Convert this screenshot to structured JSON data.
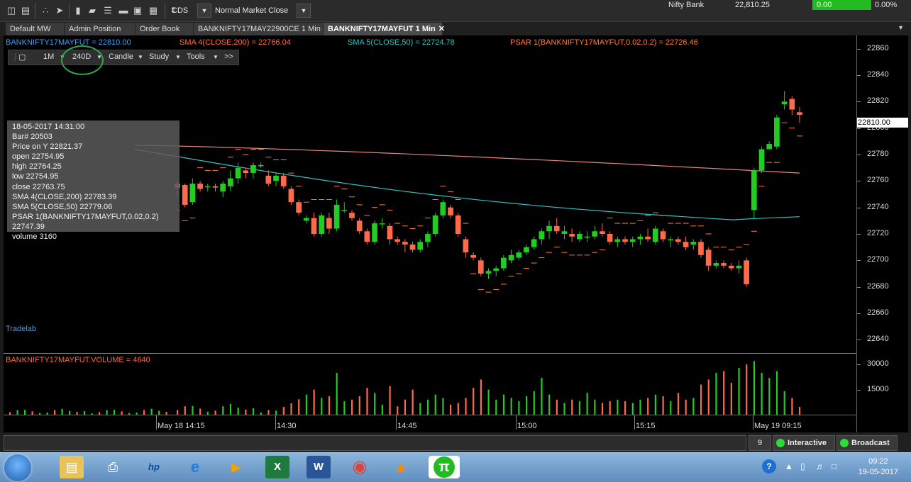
{
  "toolbar": {
    "exchange": "CDS",
    "market_status": "Normal Market Close",
    "ticker": {
      "name": "Nifty Bank",
      "value": "22,810.25",
      "change": "0.00",
      "pct": "0.00%"
    }
  },
  "tabs": [
    {
      "label": "Default MW"
    },
    {
      "label": "Admin Position"
    },
    {
      "label": "Order Book"
    },
    {
      "label": "BANKNIFTY17MAY22900CE 1 Min"
    },
    {
      "label": "BANKNIFTY17MAYFUT 1 Min",
      "close": "✕"
    }
  ],
  "indicators": {
    "price": "BANKNIFTY17MAYFUT = 22810.00",
    "sma200": "SMA 4(CLOSE,200) = 22766.04",
    "sma50": "SMA 5(CLOSE,50) = 22724.78",
    "psar": "PSAR 1(BANKNIFTY17MAYFUT,0.02,0.2) = 22726.46"
  },
  "chart_toolbar": {
    "interval": "1M",
    "duration": "240D",
    "type": "Candle",
    "study": "Study",
    "tools": "Tools",
    "more": ">>"
  },
  "infobox": [
    "18-05-2017 14:31:00",
    "Bar# 20503",
    "Price on Y  22821.37",
    "open  22754.95",
    "high  22764.25",
    "low  22754.95",
    "close  22763.75",
    "SMA 4(CLOSE,200)  22783.39",
    "SMA 5(CLOSE,50)  22779.06",
    "PSAR 1(BANKNIFTY17MAYFUT,0.02,0.2)  22747.39",
    "volume 3160"
  ],
  "watermark": "Tradelab",
  "volume_label": "BANKNIFTY17MAYFUT.VOLUME = 4640",
  "price_tag": "22810.00",
  "colors": {
    "up": "#22cc22",
    "down": "#ff6a4a",
    "sma200": "#e8857a",
    "sma50": "#2ac4c4",
    "psar": "#ff7a3a",
    "accent_green": "#22bb22"
  },
  "status": {
    "count": "9",
    "interactive": "Interactive",
    "broadcast": "Broadcast"
  },
  "taskbar": {
    "time": "09:22",
    "date": "19-05-2017"
  },
  "chart_data": {
    "type": "candlestick",
    "title": "",
    "price_axis": {
      "ticks": [
        22860,
        22840,
        22820,
        22800,
        22780,
        22760,
        22740,
        22720,
        22700,
        22680,
        22660,
        22640
      ],
      "range": [
        22630,
        22870
      ]
    },
    "volume_axis": {
      "ticks": [
        30000,
        15000
      ],
      "range": [
        0,
        36000
      ]
    },
    "time_labels": [
      "May 18 14:15",
      "14:30",
      "14:45",
      "15:00",
      "15:15",
      "May 19 09:15"
    ],
    "candles": [
      {
        "o": 22758,
        "h": 22760,
        "l": 22748,
        "c": 22755,
        "v": 2800
      },
      {
        "o": 22757,
        "h": 22758,
        "l": 22740,
        "c": 22742,
        "v": 5000
      },
      {
        "o": 22744,
        "h": 22762,
        "l": 22742,
        "c": 22758,
        "v": 5200
      },
      {
        "o": 22758,
        "h": 22760,
        "l": 22752,
        "c": 22754,
        "v": 3600
      },
      {
        "o": 22756,
        "h": 22758,
        "l": 22752,
        "c": 22756,
        "v": 1800
      },
      {
        "o": 22756,
        "h": 22758,
        "l": 22752,
        "c": 22755,
        "v": 2400
      },
      {
        "o": 22752,
        "h": 22760,
        "l": 22748,
        "c": 22758,
        "v": 5000
      },
      {
        "o": 22756,
        "h": 22768,
        "l": 22752,
        "c": 22762,
        "v": 6400
      },
      {
        "o": 22762,
        "h": 22774,
        "l": 22758,
        "c": 22770,
        "v": 4200
      },
      {
        "o": 22768,
        "h": 22770,
        "l": 22762,
        "c": 22766,
        "v": 3000
      },
      {
        "o": 22766,
        "h": 22774,
        "l": 22762,
        "c": 22772,
        "v": 3800
      },
      {
        "o": 22772,
        "h": 22774,
        "l": 22770,
        "c": 22772,
        "v": 1400
      },
      {
        "o": 22764,
        "h": 22768,
        "l": 22756,
        "c": 22758,
        "v": 2800
      },
      {
        "o": 22760,
        "h": 22766,
        "l": 22756,
        "c": 22764,
        "v": 2400
      },
      {
        "o": 22764,
        "h": 22766,
        "l": 22754,
        "c": 22756,
        "v": 4600
      },
      {
        "o": 22754,
        "h": 22756,
        "l": 22742,
        "c": 22744,
        "v": 6800
      },
      {
        "o": 22744,
        "h": 22746,
        "l": 22734,
        "c": 22736,
        "v": 9200
      },
      {
        "o": 22730,
        "h": 22734,
        "l": 22728,
        "c": 22732,
        "v": 12000
      },
      {
        "o": 22732,
        "h": 22736,
        "l": 22718,
        "c": 22720,
        "v": 15000
      },
      {
        "o": 22720,
        "h": 22736,
        "l": 22718,
        "c": 22734,
        "v": 10000
      },
      {
        "o": 22732,
        "h": 22736,
        "l": 22720,
        "c": 22724,
        "v": 11000
      },
      {
        "o": 22724,
        "h": 22746,
        "l": 22722,
        "c": 22742,
        "v": 25000
      },
      {
        "o": 22738,
        "h": 22744,
        "l": 22736,
        "c": 22738,
        "v": 8000
      },
      {
        "o": 22736,
        "h": 22738,
        "l": 22730,
        "c": 22732,
        "v": 9000
      },
      {
        "o": 22730,
        "h": 22732,
        "l": 22720,
        "c": 22722,
        "v": 11000
      },
      {
        "o": 22722,
        "h": 22724,
        "l": 22712,
        "c": 22714,
        "v": 16000
      },
      {
        "o": 22714,
        "h": 22730,
        "l": 22712,
        "c": 22728,
        "v": 13000
      },
      {
        "o": 22728,
        "h": 22732,
        "l": 22724,
        "c": 22728,
        "v": 6000
      },
      {
        "o": 22726,
        "h": 22728,
        "l": 22712,
        "c": 22716,
        "v": 17000
      },
      {
        "o": 22716,
        "h": 22718,
        "l": 22712,
        "c": 22714,
        "v": 5000
      },
      {
        "o": 22714,
        "h": 22716,
        "l": 22706,
        "c": 22712,
        "v": 9000
      },
      {
        "o": 22712,
        "h": 22714,
        "l": 22706,
        "c": 22708,
        "v": 15000
      },
      {
        "o": 22708,
        "h": 22716,
        "l": 22706,
        "c": 22714,
        "v": 7000
      },
      {
        "o": 22714,
        "h": 22722,
        "l": 22710,
        "c": 22720,
        "v": 9000
      },
      {
        "o": 22720,
        "h": 22736,
        "l": 22718,
        "c": 22734,
        "v": 12000
      },
      {
        "o": 22734,
        "h": 22746,
        "l": 22732,
        "c": 22744,
        "v": 10000
      },
      {
        "o": 22740,
        "h": 22742,
        "l": 22732,
        "c": 22734,
        "v": 6000
      },
      {
        "o": 22734,
        "h": 22736,
        "l": 22718,
        "c": 22720,
        "v": 7000
      },
      {
        "o": 22716,
        "h": 22718,
        "l": 22702,
        "c": 22706,
        "v": 10000
      },
      {
        "o": 22704,
        "h": 22706,
        "l": 22700,
        "c": 22702,
        "v": 16000
      },
      {
        "o": 22700,
        "h": 22702,
        "l": 22688,
        "c": 22690,
        "v": 21000
      },
      {
        "o": 22690,
        "h": 22694,
        "l": 22686,
        "c": 22692,
        "v": 15000
      },
      {
        "o": 22692,
        "h": 22696,
        "l": 22688,
        "c": 22694,
        "v": 9000
      },
      {
        "o": 22694,
        "h": 22704,
        "l": 22692,
        "c": 22702,
        "v": 12000
      },
      {
        "o": 22700,
        "h": 22708,
        "l": 22698,
        "c": 22704,
        "v": 10000
      },
      {
        "o": 22702,
        "h": 22708,
        "l": 22700,
        "c": 22706,
        "v": 8000
      },
      {
        "o": 22706,
        "h": 22712,
        "l": 22704,
        "c": 22710,
        "v": 11000
      },
      {
        "o": 22710,
        "h": 22718,
        "l": 22708,
        "c": 22716,
        "v": 14000
      },
      {
        "o": 22716,
        "h": 22724,
        "l": 22712,
        "c": 22722,
        "v": 22000
      },
      {
        "o": 22722,
        "h": 22730,
        "l": 22716,
        "c": 22726,
        "v": 12000
      },
      {
        "o": 22726,
        "h": 22732,
        "l": 22720,
        "c": 22722,
        "v": 9000
      },
      {
        "o": 22720,
        "h": 22726,
        "l": 22716,
        "c": 22722,
        "v": 7000
      },
      {
        "o": 22720,
        "h": 22724,
        "l": 22714,
        "c": 22718,
        "v": 9000
      },
      {
        "o": 22716,
        "h": 22722,
        "l": 22714,
        "c": 22720,
        "v": 8000
      },
      {
        "o": 22718,
        "h": 22722,
        "l": 22714,
        "c": 22718,
        "v": 13000
      },
      {
        "o": 22718,
        "h": 22726,
        "l": 22716,
        "c": 22722,
        "v": 9000
      },
      {
        "o": 22722,
        "h": 22728,
        "l": 22718,
        "c": 22720,
        "v": 7000
      },
      {
        "o": 22720,
        "h": 22722,
        "l": 22712,
        "c": 22714,
        "v": 8000
      },
      {
        "o": 22714,
        "h": 22718,
        "l": 22710,
        "c": 22716,
        "v": 9000
      },
      {
        "o": 22716,
        "h": 22718,
        "l": 22712,
        "c": 22714,
        "v": 8000
      },
      {
        "o": 22714,
        "h": 22718,
        "l": 22710,
        "c": 22716,
        "v": 7000
      },
      {
        "o": 22716,
        "h": 22720,
        "l": 22712,
        "c": 22718,
        "v": 9000
      },
      {
        "o": 22718,
        "h": 22724,
        "l": 22714,
        "c": 22716,
        "v": 10000
      },
      {
        "o": 22714,
        "h": 22726,
        "l": 22712,
        "c": 22724,
        "v": 12000
      },
      {
        "o": 22722,
        "h": 22724,
        "l": 22714,
        "c": 22716,
        "v": 11000
      },
      {
        "o": 22716,
        "h": 22718,
        "l": 22710,
        "c": 22716,
        "v": 8000
      },
      {
        "o": 22716,
        "h": 22718,
        "l": 22712,
        "c": 22714,
        "v": 13000
      },
      {
        "o": 22714,
        "h": 22718,
        "l": 22708,
        "c": 22710,
        "v": 9000
      },
      {
        "o": 22712,
        "h": 22716,
        "l": 22708,
        "c": 22714,
        "v": 10000
      },
      {
        "o": 22714,
        "h": 22716,
        "l": 22702,
        "c": 22704,
        "v": 18000
      },
      {
        "o": 22708,
        "h": 22710,
        "l": 22692,
        "c": 22696,
        "v": 21000
      },
      {
        "o": 22696,
        "h": 22700,
        "l": 22694,
        "c": 22698,
        "v": 25000
      },
      {
        "o": 22698,
        "h": 22700,
        "l": 22694,
        "c": 22696,
        "v": 26000
      },
      {
        "o": 22696,
        "h": 22698,
        "l": 22692,
        "c": 22694,
        "v": 19000
      },
      {
        "o": 22694,
        "h": 22700,
        "l": 22690,
        "c": 22696,
        "v": 28000
      },
      {
        "o": 22700,
        "h": 22702,
        "l": 22680,
        "c": 22682,
        "v": 30000
      },
      {
        "o": 22738,
        "h": 22770,
        "l": 22732,
        "c": 22768,
        "v": 32000
      },
      {
        "o": 22768,
        "h": 22786,
        "l": 22766,
        "c": 22784,
        "v": 25000
      },
      {
        "o": 22784,
        "h": 22790,
        "l": 22784,
        "c": 22788,
        "v": 22000
      },
      {
        "o": 22786,
        "h": 22810,
        "l": 22784,
        "c": 22808,
        "v": 26000
      },
      {
        "o": 22818,
        "h": 22828,
        "l": 22814,
        "c": 22820,
        "v": 14000
      },
      {
        "o": 22822,
        "h": 22824,
        "l": 22810,
        "c": 22814,
        "v": 10000
      },
      {
        "o": 22812,
        "h": 22816,
        "l": 22804,
        "c": 22810,
        "v": 4640
      }
    ],
    "sma200": {
      "start": 22787,
      "end": 22766
    },
    "sma50": {
      "start": 22784,
      "end": 22725
    }
  }
}
